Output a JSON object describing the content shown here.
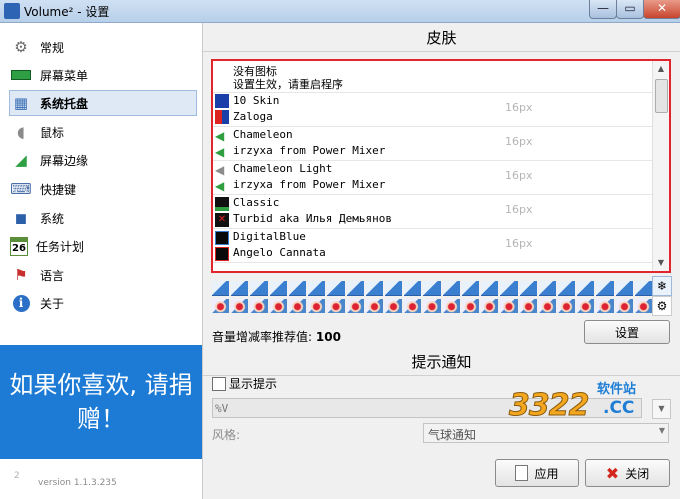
{
  "window": {
    "title": "Volume² - 设置",
    "min": "—",
    "max": "▭",
    "close": "✕"
  },
  "sidebar": {
    "items": [
      {
        "label": "常规",
        "icon": "gears-icon",
        "glyph": "⚙"
      },
      {
        "label": "屏幕菜单",
        "icon": "screen-menu-icon",
        "glyph": "▬"
      },
      {
        "label": "系统托盘",
        "icon": "system-tray-icon",
        "glyph": "▦"
      },
      {
        "label": "鼠标",
        "icon": "mouse-icon",
        "glyph": "◖"
      },
      {
        "label": "屏幕边缘",
        "icon": "screen-edge-icon",
        "glyph": "◢"
      },
      {
        "label": "快捷键",
        "icon": "hotkey-icon",
        "glyph": "⌨"
      },
      {
        "label": "系统",
        "icon": "system-icon",
        "glyph": "◼"
      },
      {
        "label": "任务计划",
        "icon": "calendar-icon",
        "glyph": "26"
      },
      {
        "label": "语言",
        "icon": "language-flag-icon",
        "glyph": "⚑"
      },
      {
        "label": "关于",
        "icon": "info-icon",
        "glyph": "i"
      }
    ],
    "active_index": 2,
    "promo_text": "如果你喜欢, 请捐赠！",
    "version": "version 1.1.3.235",
    "version_logo": "2"
  },
  "skin_section": {
    "heading": "皮肤",
    "no_icon_line1": "没有图标",
    "no_icon_line2": "设置生效，请重启程序",
    "skins": [
      {
        "name": "10 Skin",
        "author": "Zaloga",
        "size": "16px",
        "icon": "skin-10-icon"
      },
      {
        "name": "Chameleon",
        "author": "irzyxa from Power Mixer",
        "size": "16px",
        "icon": "speaker-icon"
      },
      {
        "name": "Chameleon Light",
        "author": "irzyxa from Power Mixer",
        "size": "16px",
        "icon": "speaker-icon"
      },
      {
        "name": "Classic",
        "author": "Turbid aka Илья Демьянов",
        "size": "16px",
        "icon": "classic-skin-icon"
      },
      {
        "name": "DigitalBlue",
        "author": "Angelo Cannata",
        "size": "16px",
        "icon": "digital-blue-icon"
      }
    ],
    "recommended_label": "音量增减率推荐值:",
    "recommended_value": "100",
    "settings_button": "设置"
  },
  "notify_section": {
    "heading": "提示通知",
    "show_hint_label": "显示提示",
    "show_hint_checked": false,
    "format_value": "%V",
    "style_label": "风格:",
    "style_value": "气球通知"
  },
  "footer": {
    "apply_button": "应用",
    "close_button": "关闭"
  },
  "watermark": {
    "number": "3322",
    "domain": ".CC",
    "site": "软件站"
  }
}
